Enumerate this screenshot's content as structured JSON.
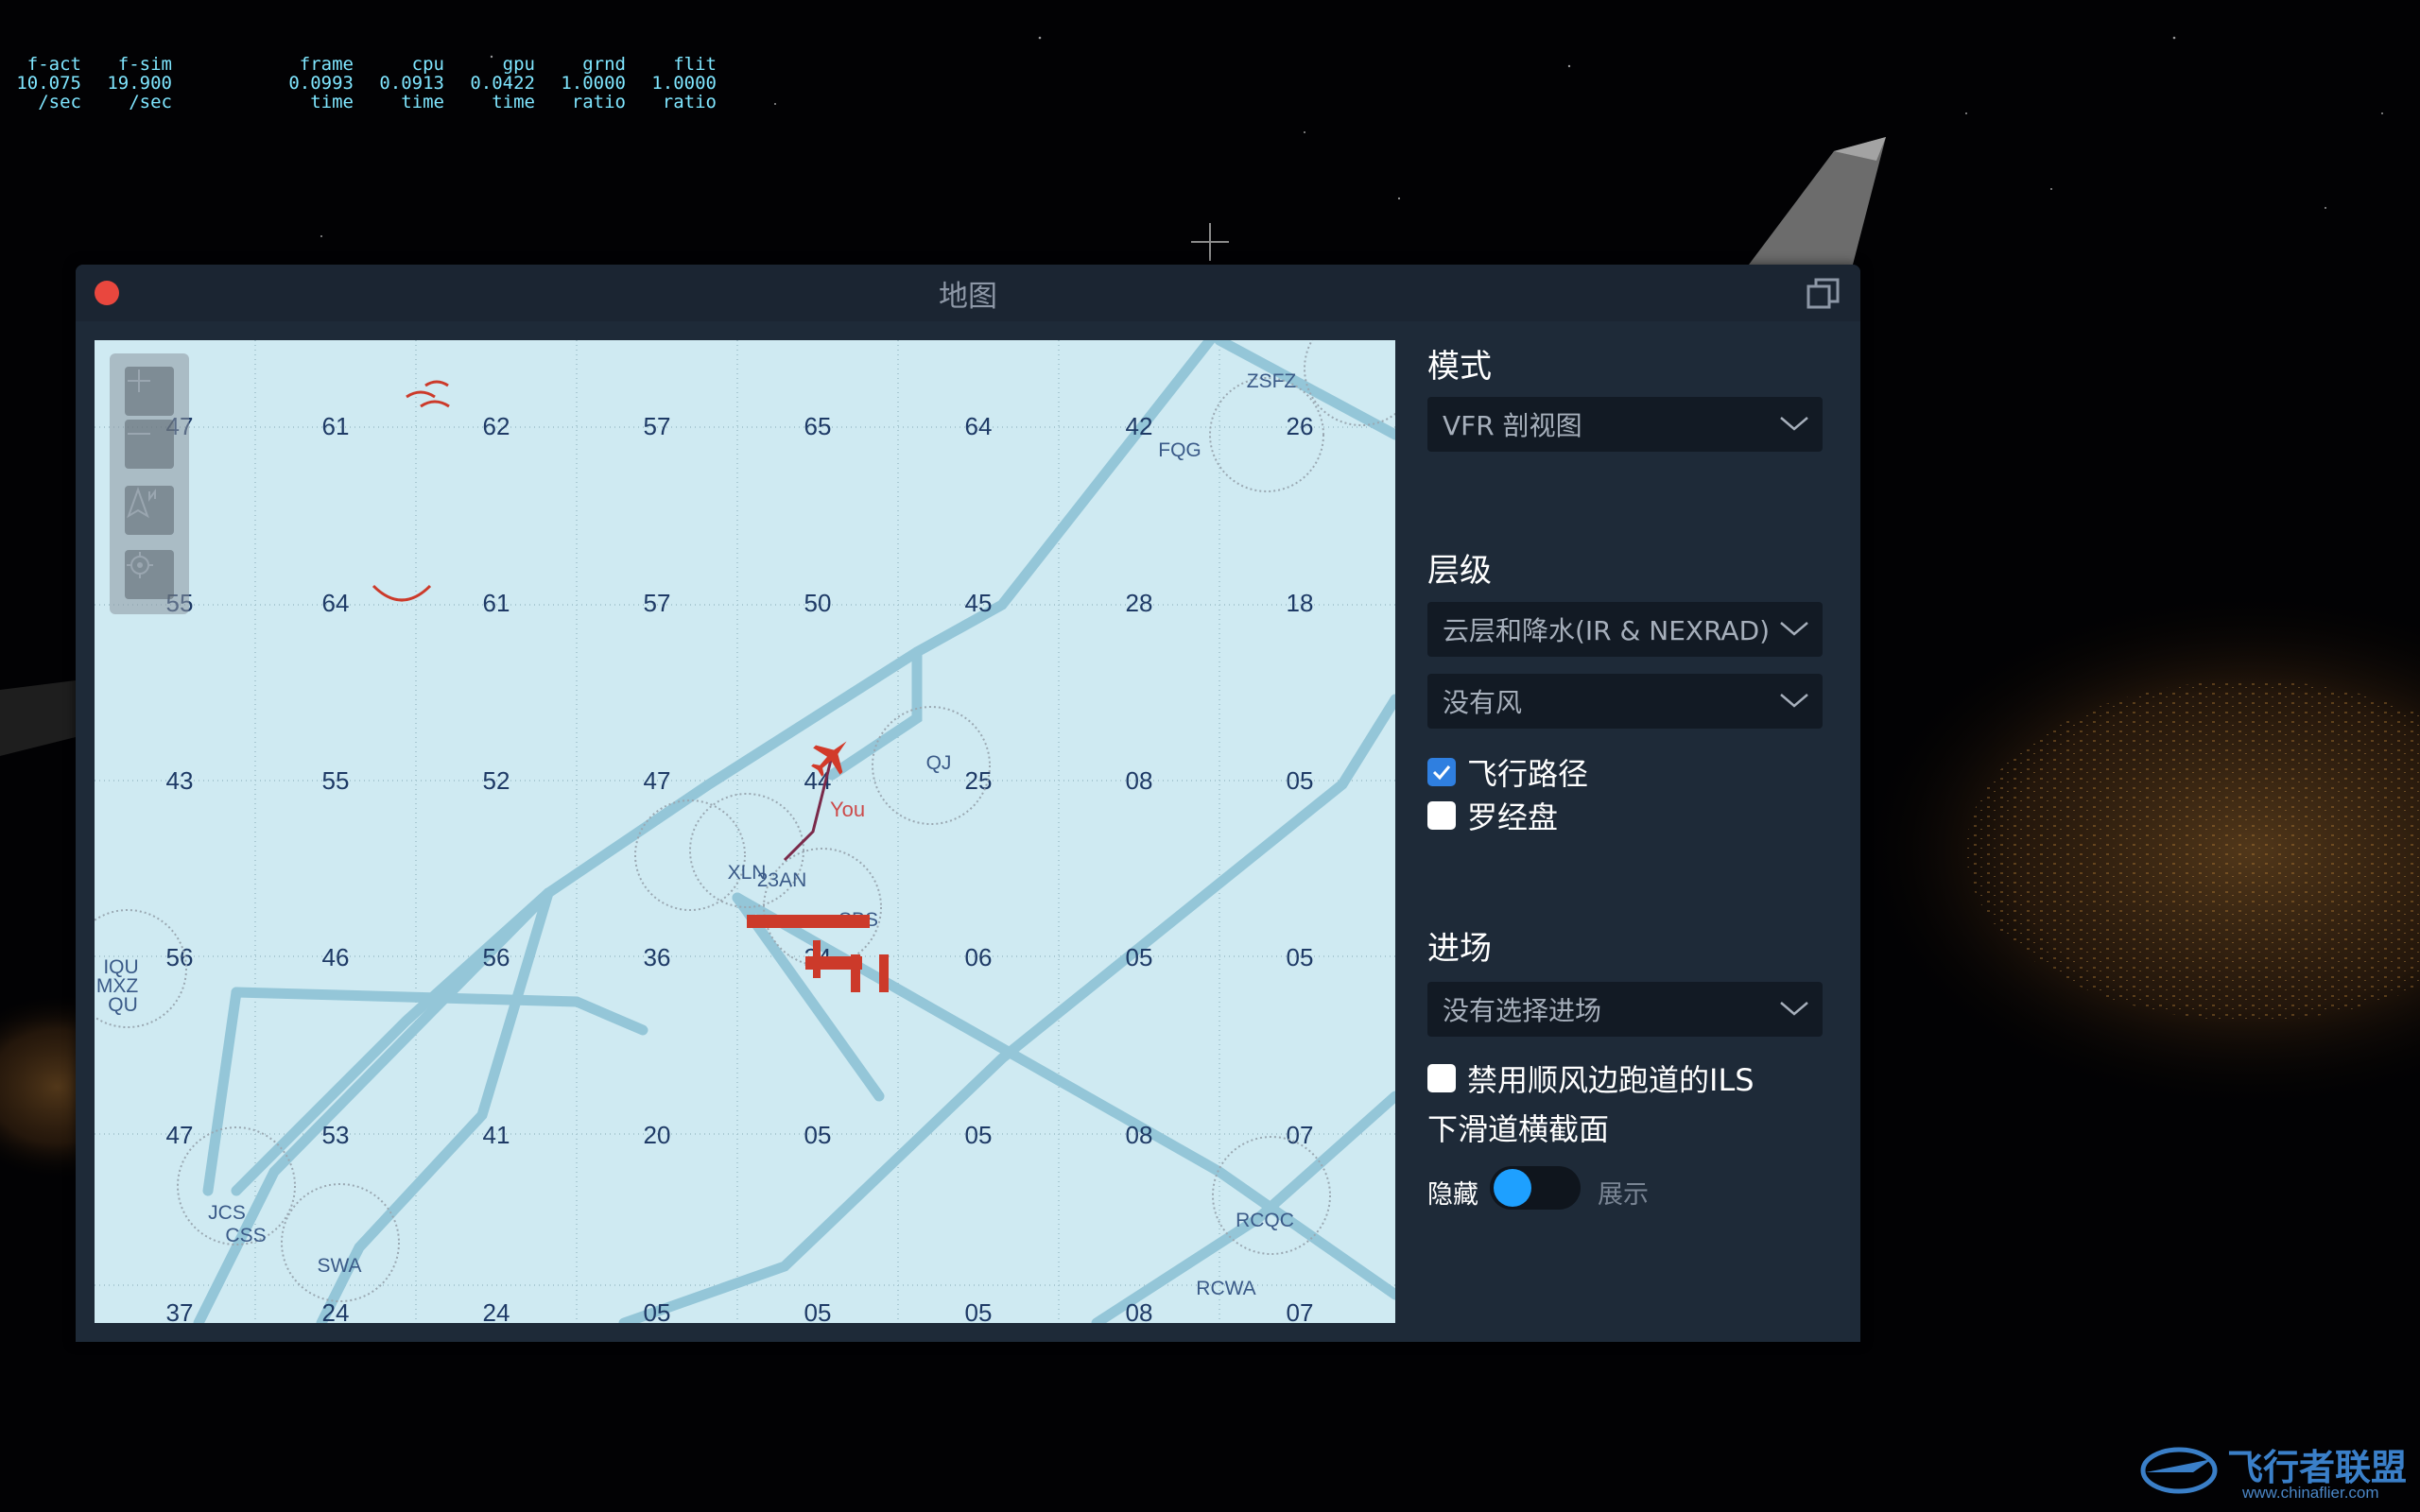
{
  "perf_stats": {
    "columns": [
      {
        "header": "f-act",
        "value": "10.075",
        "unit": "/sec"
      },
      {
        "header": "f-sim",
        "value": "19.900",
        "unit": "/sec"
      },
      {
        "header": "frame",
        "value": "0.0993",
        "unit": "time"
      },
      {
        "header": "cpu",
        "value": "0.0913",
        "unit": "time"
      },
      {
        "header": "gpu",
        "value": "0.0422",
        "unit": "time"
      },
      {
        "header": "grnd",
        "value": "1.0000",
        "unit": "ratio"
      },
      {
        "header": "flit",
        "value": "1.0000",
        "unit": "ratio"
      }
    ]
  },
  "window": {
    "title": "地图",
    "close_icon": "close-icon",
    "popout_icon": "popout-window-icon"
  },
  "map": {
    "controls": [
      "zoom-in-icon",
      "zoom-out-icon",
      "north-up-icon",
      "center-location-icon"
    ],
    "grid_numbers": [
      [
        "47",
        "61",
        "62",
        "57",
        "65",
        "64",
        "42",
        "26"
      ],
      [
        "55",
        "64",
        "61",
        "57",
        "50",
        "45",
        "28",
        "18"
      ],
      [
        "43",
        "55",
        "52",
        "47",
        "44",
        "25",
        "08",
        "05"
      ],
      [
        "56",
        "46",
        "56",
        "36",
        "24",
        "06",
        "05",
        "05"
      ],
      [
        "47",
        "53",
        "41",
        "20",
        "05",
        "05",
        "08",
        "07"
      ],
      [
        "37",
        "24",
        "24",
        "05",
        "05",
        "05",
        "08",
        "07"
      ]
    ],
    "station_labels": [
      "ZSFZ",
      "FQG",
      "QJ",
      "XLN",
      "23AN",
      "SBS",
      "IQU",
      "MXZ",
      "QU",
      "JCS",
      "CSS",
      "SWA",
      "RCQC",
      "RCWA"
    ],
    "aircraft_label": "You",
    "colors": {
      "background": "#cfeaf2",
      "grid_number": "#1e3a66",
      "airway": "#8fc3d6",
      "aircraft": "#cc3a2a"
    }
  },
  "panel": {
    "mode": {
      "title": "模式",
      "value": "VFR 剖视图"
    },
    "layer": {
      "title": "层级",
      "weather_value": "云层和降水(IR & NEXRAD)",
      "wind_value": "没有风"
    },
    "checks": [
      {
        "label": "飞行路径",
        "checked": true
      },
      {
        "label": "罗经盘",
        "checked": false
      }
    ],
    "approach": {
      "title": "进场",
      "value": "没有选择进场"
    },
    "ils_check": {
      "label": "禁用顺风边跑道的ILS",
      "checked": false
    },
    "glideslope": {
      "title": "下滑道横截面",
      "left_label": "隐藏",
      "right_label": "展示",
      "state": "hidden"
    }
  },
  "watermark": {
    "name": "飞行者联盟",
    "url": "www.chinaflier.com"
  }
}
